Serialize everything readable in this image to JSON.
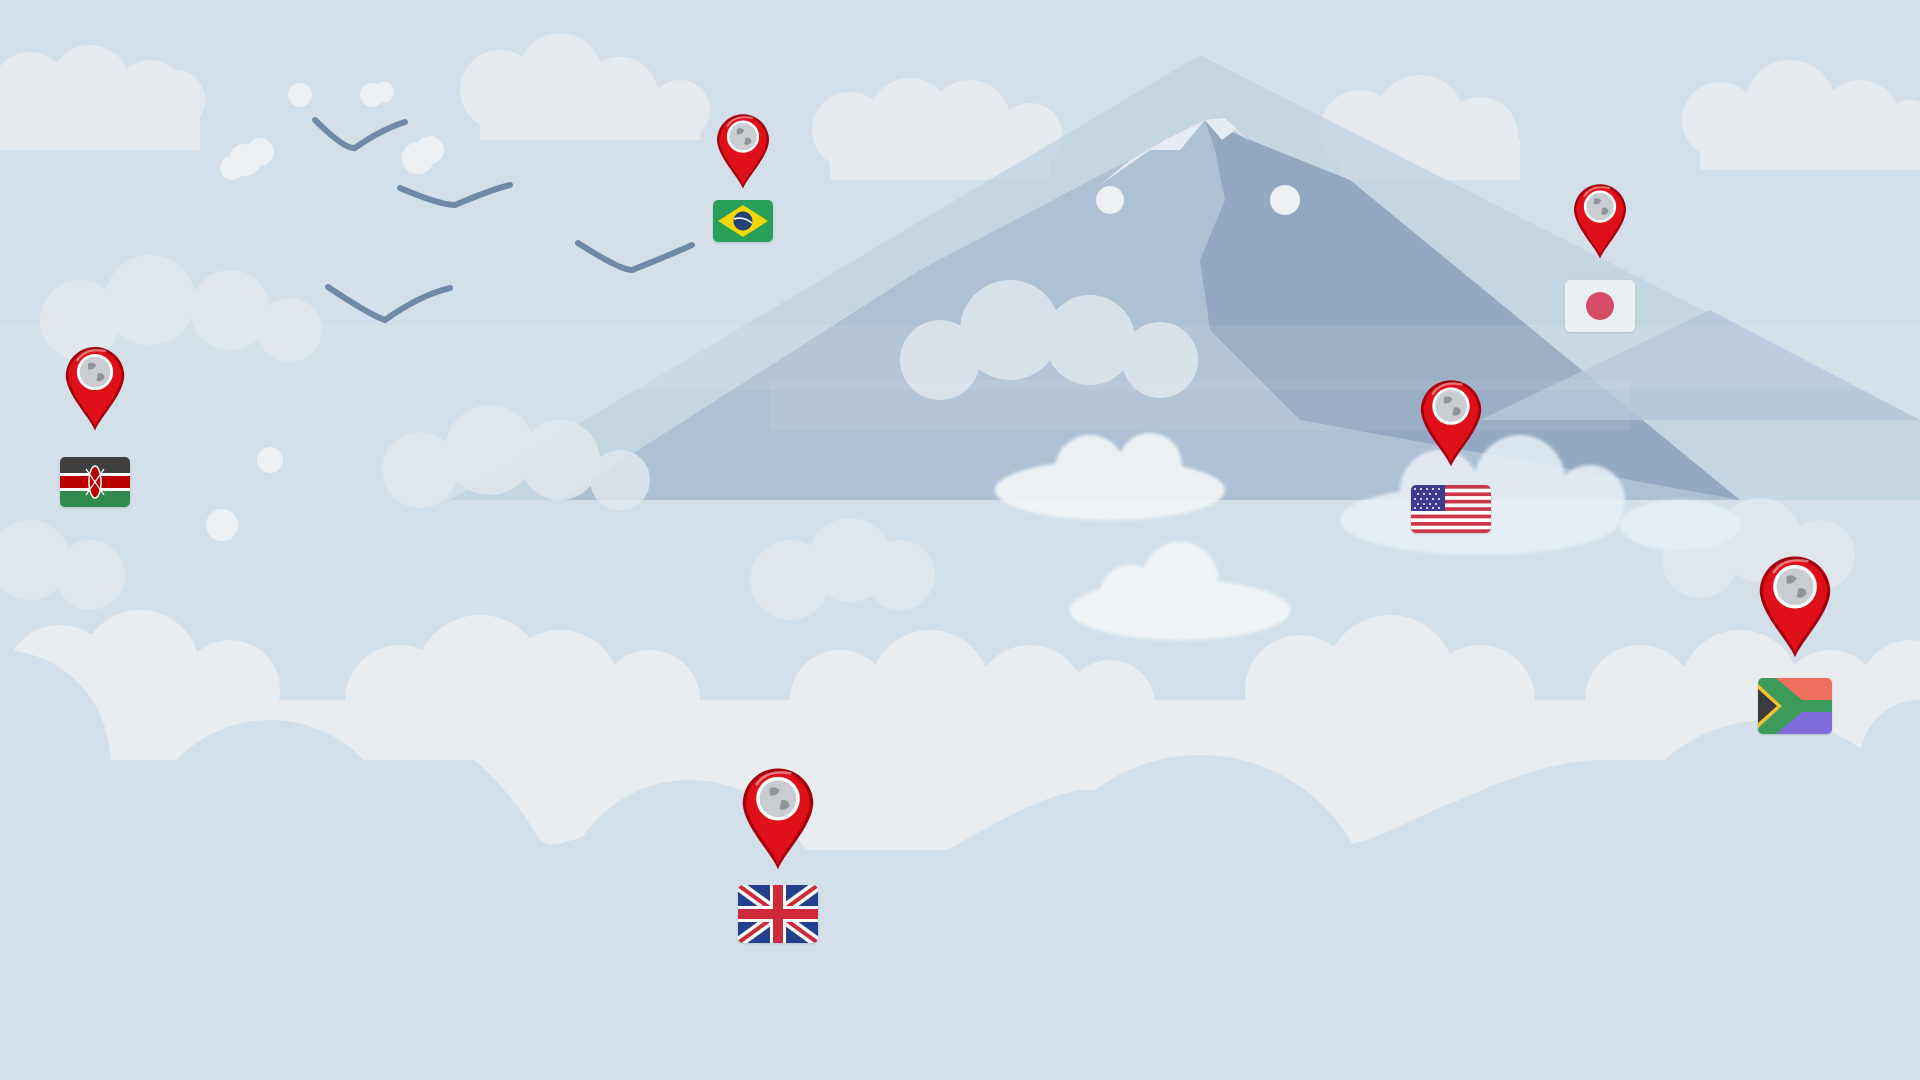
{
  "scene": {
    "sky_color": "#d3e0e9",
    "mountain_colors": [
      "#b9ccdc",
      "#9fb4ca",
      "#8aa0b8"
    ],
    "cloud_color": "#eef1f2",
    "bird_color": "#6f8aa6"
  },
  "pin_style": {
    "color": "#e0101b",
    "dark_color": "#a5000c",
    "globe_color": "#c9cdd1",
    "icon": "globe-pin-icon"
  },
  "markers": [
    {
      "id": "kenya",
      "flag": "kenya-flag-icon",
      "flag_colors": [
        "#1f1f1f",
        "#ffffff",
        "#bb0000",
        "#006600"
      ]
    },
    {
      "id": "brazil",
      "flag": "brazil-flag-icon",
      "flag_colors": [
        "#009c3b",
        "#ffdf00",
        "#002776"
      ]
    },
    {
      "id": "japan",
      "flag": "japan-flag-icon",
      "flag_colors": [
        "#ffffff",
        "#bc002d"
      ]
    },
    {
      "id": "usa",
      "flag": "usa-flag-icon",
      "flag_colors": [
        "#b22234",
        "#ffffff",
        "#3c3b6e"
      ]
    },
    {
      "id": "south-africa",
      "flag": "south-africa-flag-icon",
      "flag_colors": [
        "#e03c31",
        "#001489",
        "#007749",
        "#ffb81c",
        "#000000",
        "#ffffff"
      ]
    },
    {
      "id": "united-kingdom",
      "flag": "united-kingdom-flag-icon",
      "flag_colors": [
        "#012169",
        "#ffffff",
        "#c8102e"
      ]
    }
  ]
}
